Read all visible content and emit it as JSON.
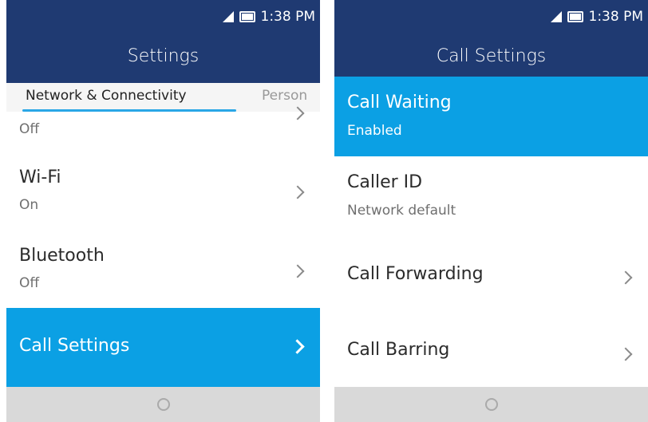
{
  "status_bar": {
    "time": "1:38 PM"
  },
  "left": {
    "title": "Settings",
    "tabs": [
      {
        "label": "Network & Connectivity"
      },
      {
        "label": "Person"
      }
    ],
    "items": [
      {
        "label": "",
        "sub": "Off"
      },
      {
        "label": "Wi-Fi",
        "sub": "On"
      },
      {
        "label": "Bluetooth",
        "sub": "Off"
      },
      {
        "label": "Call Settings",
        "sub": ""
      }
    ]
  },
  "right": {
    "title": "Call Settings",
    "items": [
      {
        "label": "Call Waiting",
        "sub": "Enabled"
      },
      {
        "label": "Caller ID",
        "sub": "Network default"
      },
      {
        "label": "Call Forwarding",
        "sub": ""
      },
      {
        "label": "Call Barring",
        "sub": ""
      }
    ]
  },
  "colors": {
    "header": "#1f3a72",
    "highlight": "#0ba0e4",
    "tab_indicator": "#2aa7e6",
    "softkey_bar": "#d9d9d9"
  },
  "icons": [
    "signal-icon",
    "battery-icon",
    "chevron-right-icon",
    "home-button-icon"
  ]
}
